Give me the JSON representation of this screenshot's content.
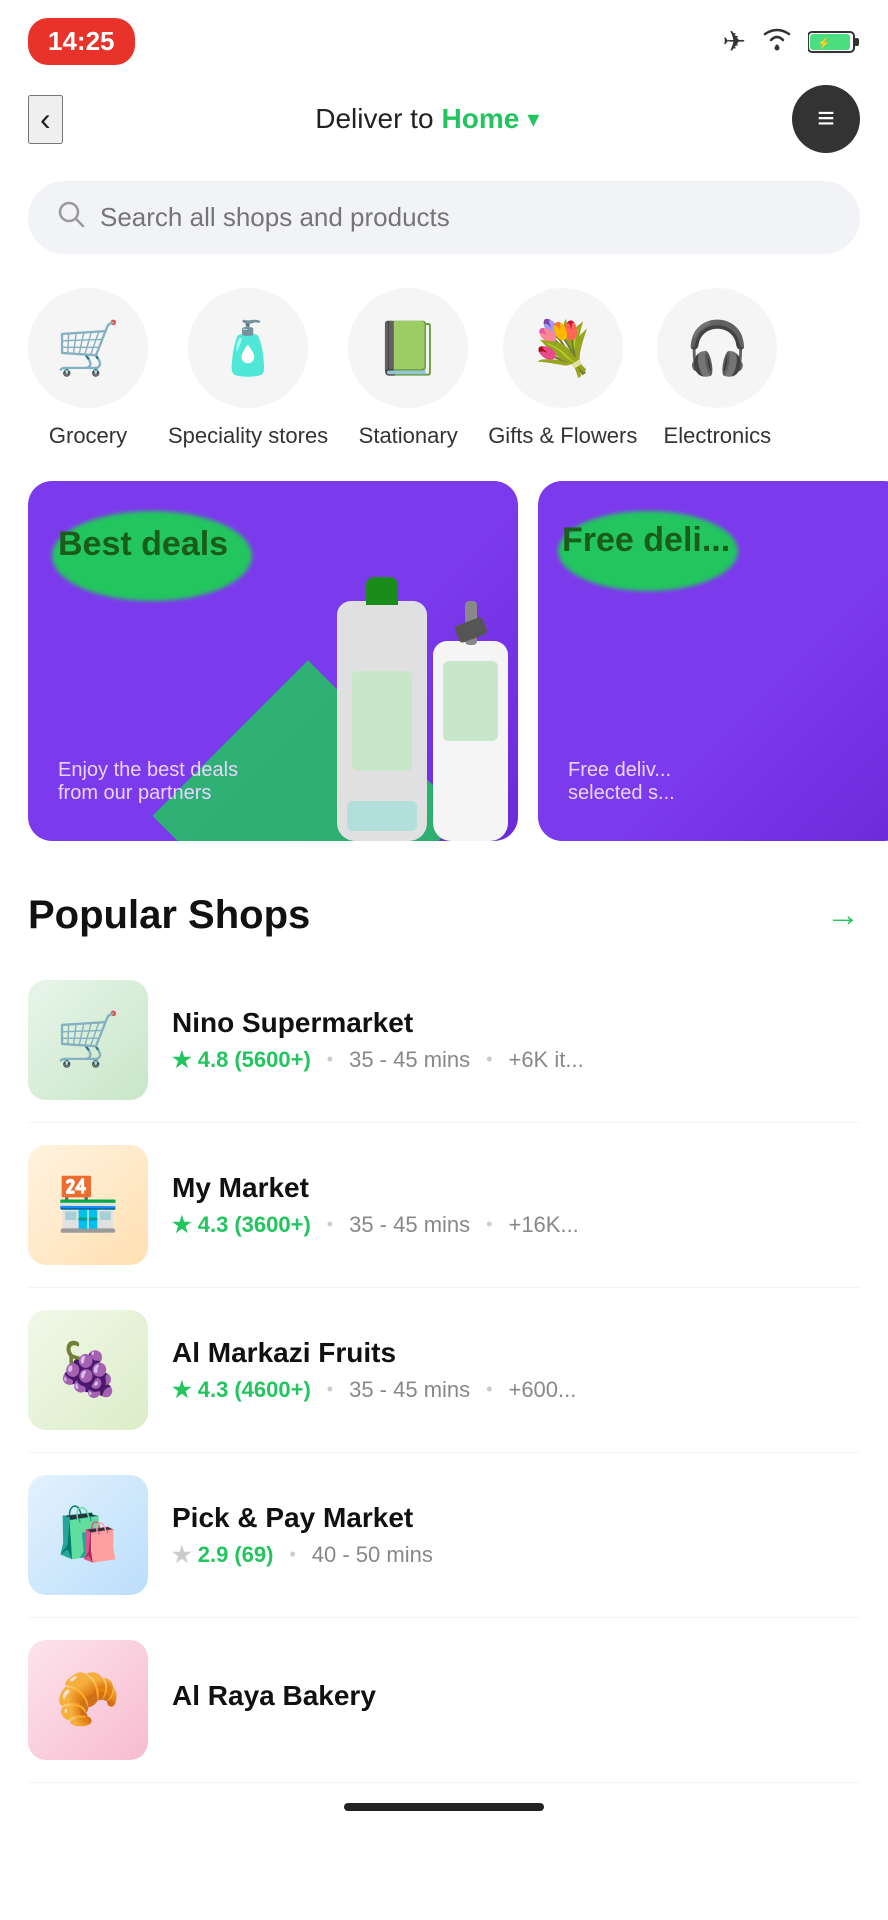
{
  "statusBar": {
    "time": "14:25",
    "icons": [
      "airplane",
      "wifi",
      "battery"
    ]
  },
  "header": {
    "backLabel": "‹",
    "deliverText": "Deliver to",
    "location": "Home",
    "chevron": "▾",
    "menuIcon": "≡"
  },
  "search": {
    "placeholder": "Search all shops and products"
  },
  "categories": [
    {
      "id": "grocery",
      "label": "Grocery",
      "emoji": "🛒"
    },
    {
      "id": "speciality",
      "label": "Speciality stores",
      "emoji": "🧴"
    },
    {
      "id": "stationary",
      "label": "Stationary",
      "emoji": "📗"
    },
    {
      "id": "gifts",
      "label": "Gifts & Flowers",
      "emoji": "💐"
    },
    {
      "id": "electronics",
      "label": "Electronics",
      "emoji": "🎧"
    }
  ],
  "banners": [
    {
      "id": "best-deals",
      "title": "Best deals",
      "subtitle": "Enjoy the best deals\nfrom our partners",
      "bg": "#7c3aed"
    },
    {
      "id": "free-delivery",
      "title": "Free deli...",
      "subtitle": "Free deliv...\nselected s...",
      "bg": "#7c3aed"
    }
  ],
  "popularShops": {
    "sectionTitle": "Popular Shops",
    "arrowLabel": "→",
    "shops": [
      {
        "name": "Nino Supermarket",
        "rating": "4.8",
        "reviews": "(5600+)",
        "time": "35 - 45 mins",
        "items": "+6K it...",
        "emoji": "🛒",
        "starFilled": true
      },
      {
        "name": "My Market",
        "rating": "4.3",
        "reviews": "(3600+)",
        "time": "35 - 45 mins",
        "items": "+16K...",
        "emoji": "🏪",
        "starFilled": true
      },
      {
        "name": "Al Markazi Fruits",
        "rating": "4.3",
        "reviews": "(4600+)",
        "time": "35 - 45 mins",
        "items": "+600...",
        "emoji": "🍇",
        "starFilled": true
      },
      {
        "name": "Pick & Pay Market",
        "rating": "2.9",
        "reviews": "(69)",
        "time": "40 - 50 mins",
        "items": "",
        "emoji": "🛍️",
        "starFilled": false
      },
      {
        "name": "Al Raya Bakery",
        "rating": "",
        "reviews": "",
        "time": "",
        "items": "",
        "emoji": "🥐",
        "starFilled": false
      }
    ]
  }
}
